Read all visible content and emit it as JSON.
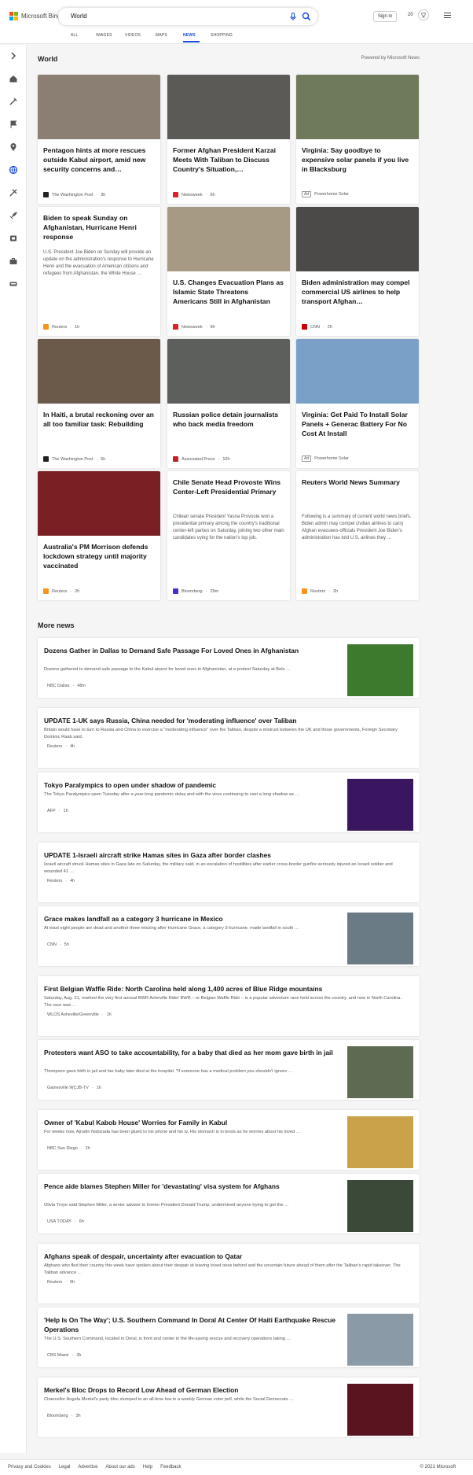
{
  "header": {
    "brand": "Microsoft Bing",
    "query": "World",
    "signin": "Sign in",
    "rewards_points": "20",
    "tabs": [
      "ALL",
      "IMAGES",
      "VIDEOS",
      "MAPS",
      "NEWS",
      "SHOPPING"
    ],
    "active_tab": "NEWS"
  },
  "sidebar_icons": [
    "chevron-right-icon",
    "home-icon",
    "tools-icon",
    "flag-icon",
    "location-icon",
    "globe-icon",
    "science-icon",
    "rocket-icon",
    "film-icon",
    "briefcase-icon",
    "car-icon"
  ],
  "world": {
    "title": "World",
    "powered": "Powered by Microsoft News",
    "cards": [
      {
        "title": "Pentagon hints at more rescues outside Kabul airport, amid new security concerns and…",
        "snippet": "",
        "source": "The Washington Post",
        "age": "3h",
        "ad": false,
        "img": "#8a7f72"
      },
      {
        "title": "Former Afghan President Karzai Meets With Taliban to Discuss Country's Situation,…",
        "snippet": "",
        "source": "Newsweek",
        "age": "6h",
        "ad": false,
        "img": "#5b5a57"
      },
      {
        "title": "Virginia: Say goodbye to expensive solar panels if you live in Blacksburg",
        "snippet": "",
        "source": "Powerhome Solar",
        "age": "",
        "ad": true,
        "img": "#6f7a5a"
      },
      {
        "title": "Biden to speak Sunday on Afghanistan, Hurricane Henri response",
        "snippet": "U.S. President Joe Biden on Sunday will provide an update on the administration's response to Hurricane Henri and the evacuation of American citizens and refugees from Afghanistan, the White House …",
        "source": "Reuters",
        "age": "1h",
        "ad": false,
        "img": ""
      },
      {
        "title": "U.S. Changes Evacuation Plans as Islamic State Threatens Americans Still in Afghanistan",
        "snippet": "",
        "source": "Newsweek",
        "age": "9h",
        "ad": false,
        "img": "#a79a84"
      },
      {
        "title": "Biden administration may compel commercial US airlines to help transport Afghan…",
        "snippet": "",
        "source": "CNN",
        "age": "2h",
        "ad": false,
        "img": "#4b4a48"
      },
      {
        "title": "In Haiti, a brutal reckoning over an all too familiar task: Rebuilding",
        "snippet": "",
        "source": "The Washington Post",
        "age": "5h",
        "ad": false,
        "img": "#6b5a4a"
      },
      {
        "title": "Russian police detain journalists who back media freedom",
        "snippet": "",
        "source": "Associated Press",
        "age": "10h",
        "ad": false,
        "img": "#5d5f5c"
      },
      {
        "title": "Virginia: Get Paid To Install Solar Panels + Generac Battery For No Cost At Install",
        "snippet": "",
        "source": "Powerhome Solar",
        "age": "",
        "ad": true,
        "img": "#7aa0c8"
      },
      {
        "title": "Australia's PM Morrison defends lockdown strategy until majority vaccinated",
        "snippet": "",
        "source": "Reuters",
        "age": "2h",
        "ad": false,
        "img": "#7a1f24"
      },
      {
        "title": "Chile Senate Head Provoste Wins Center-Left Presidential Primary",
        "snippet": "Chilean senate President Yasna Provoste won a presidential primary among the country's traditional center-left parties on Saturday, joining two other main candidates vying for the nation's top job.",
        "source": "Bloomberg",
        "age": "29m",
        "ad": false,
        "img": ""
      },
      {
        "title": "Reuters World News Summary",
        "snippet": "Following is a summary of current world news briefs. Biden admin may compel civilian airlines to carry Afghan evacuees-officials President Joe Biden's administration has told U.S. airlines they …",
        "source": "Reuters",
        "age": "2h",
        "ad": false,
        "img": ""
      }
    ]
  },
  "more": {
    "title": "More news",
    "items": [
      {
        "title": "Dozens Gather in Dallas to Demand Safe Passage For Loved Ones in Afghanistan",
        "snippet": "Dozens gathered to demand safe passage to the Kabul airport for loved ones in Afghanistan, at a protest Saturday at Belo …",
        "source": "NBC Dallas",
        "age": "48m",
        "img": "#3e7a2e"
      },
      {
        "title": "UPDATE 1-UK says Russia, China needed for 'moderating influence' over Taliban",
        "snippet": "Britain would have to turn to Russia and China to exercise a \"moderating influence\" over the Taliban, despite a mistrust between the UK and those governments, Foreign Secretary Dominic Raab said.",
        "source": "Reuters",
        "age": "4h",
        "img": ""
      },
      {
        "title": "Tokyo Paralympics to open under shadow of pandemic",
        "snippet": "The Tokyo Paralympics open Tuesday after a year-long pandemic delay and with the virus continuing to cast a long shadow as …",
        "source": "AFP",
        "age": "1h",
        "img": "#3a1560"
      },
      {
        "title": "UPDATE 1-Israeli aircraft strike Hamas sites in Gaza after border clashes",
        "snippet": "Israeli aircraft struck Hamas sites in Gaza late on Saturday, the military said, in an escalation of hostilities after earlier cross-border gunfire seriously injured an Israeli soldier and wounded 41 …",
        "source": "Reuters",
        "age": "4h",
        "img": ""
      },
      {
        "title": "Grace makes landfall as a category 3 hurricane in Mexico",
        "snippet": "At least eight people are dead and another three missing after Hurricane Grace, a category 3 hurricane, made landfall in south …",
        "source": "CNN",
        "age": "5h",
        "img": "#6b7b86"
      },
      {
        "title": "First Belgian Waffle Ride: North Carolina held along 1,400 acres of Blue Ridge mountains",
        "snippet": "Saturday, Aug. 21, marked the very first annual BWR Asheville Ride! BWR – or Belgian Waffle Ride – is a popular adventure race held across the country, and now in North Carolina. The race was …",
        "source": "WLOS Asheville/Greenville",
        "age": "1h",
        "img": ""
      },
      {
        "title": "Protesters want ASO to take accountability, for a baby that died as her mom gave birth in jail",
        "snippet": "Thompson gave birth in jail and her baby later died at the hospital. \"If someone has a medical problem you shouldn't ignore …",
        "source": "Gainesville WCJB-TV",
        "age": "1h",
        "img": "#5d6b52"
      },
      {
        "title": "Owner of 'Kabul Kabob House' Worries for Family in Kabul",
        "snippet": "For weeks now, Ajrudin Nabizada has been glued to his phone and his tv. His stomach is in knots as he worries about his loved …",
        "source": "NBC San Diego",
        "age": "2h",
        "img": "#c9a24a"
      },
      {
        "title": "Pence aide blames Stephen Miller for 'devastating' visa system for Afghans",
        "snippet": "Olivia Troye said Stephen Miller, a senior adviser to former President Donald Trump, undermined anyone trying to get the …",
        "source": "USA TODAY",
        "age": "6h",
        "img": "#3b4a38"
      },
      {
        "title": "Afghans speak of despair, uncertainty after evacuation to Qatar",
        "snippet": "Afghans who fled their country this week have spoken about their despair at leaving loved ones behind and the uncertain future ahead of them after the Taliban's rapid takeover. The Taliban advance …",
        "source": "Reuters",
        "age": "6h",
        "img": ""
      },
      {
        "title": "'Help Is On The Way'; U.S. Southern Command In Doral At Center Of Haiti Earthquake Rescue Operations",
        "snippet": "The U.S. Southern Command, located in Doral, is front and center in the life-saving rescue and recovery operations taking …",
        "source": "CBS Miami",
        "age": "3h",
        "img": "#8a9aa6"
      },
      {
        "title": "Merkel's Bloc Drops to Record Low Ahead of German Election",
        "snippet": "Chancellor Angela Merkel's party bloc slumped to an all-time low in a weekly German voter poll, while the Social Democrats …",
        "source": "Bloomberg",
        "age": "3h",
        "img": "#5a1420"
      }
    ]
  },
  "footer": {
    "links": [
      "Privacy and Cookies",
      "Legal",
      "Advertise",
      "About our ads",
      "Help",
      "Feedback"
    ],
    "copyright": "© 2021 Microsoft"
  },
  "colors": {
    "accent": "#174ae4",
    "ms_red": "#f25022",
    "ms_green": "#7fba00",
    "ms_blue": "#00a4ef",
    "ms_yellow": "#ffb900"
  }
}
